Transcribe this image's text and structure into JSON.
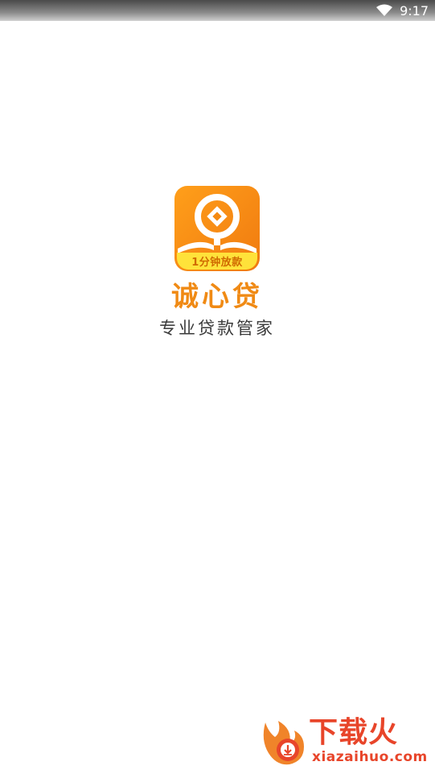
{
  "status_bar": {
    "time": "9:17",
    "icons": [
      "wifi-icon"
    ]
  },
  "splash": {
    "app_icon_badge": "1分钟放款",
    "app_name": "诚心贷",
    "slogan": "专业贷款管家"
  },
  "watermark": {
    "title": "下载火",
    "domain": "xiazaihuo.com"
  },
  "colors": {
    "brand_orange": "#f08a14",
    "badge_yellow": "#ffe23a",
    "watermark_red": "#e8452a"
  }
}
